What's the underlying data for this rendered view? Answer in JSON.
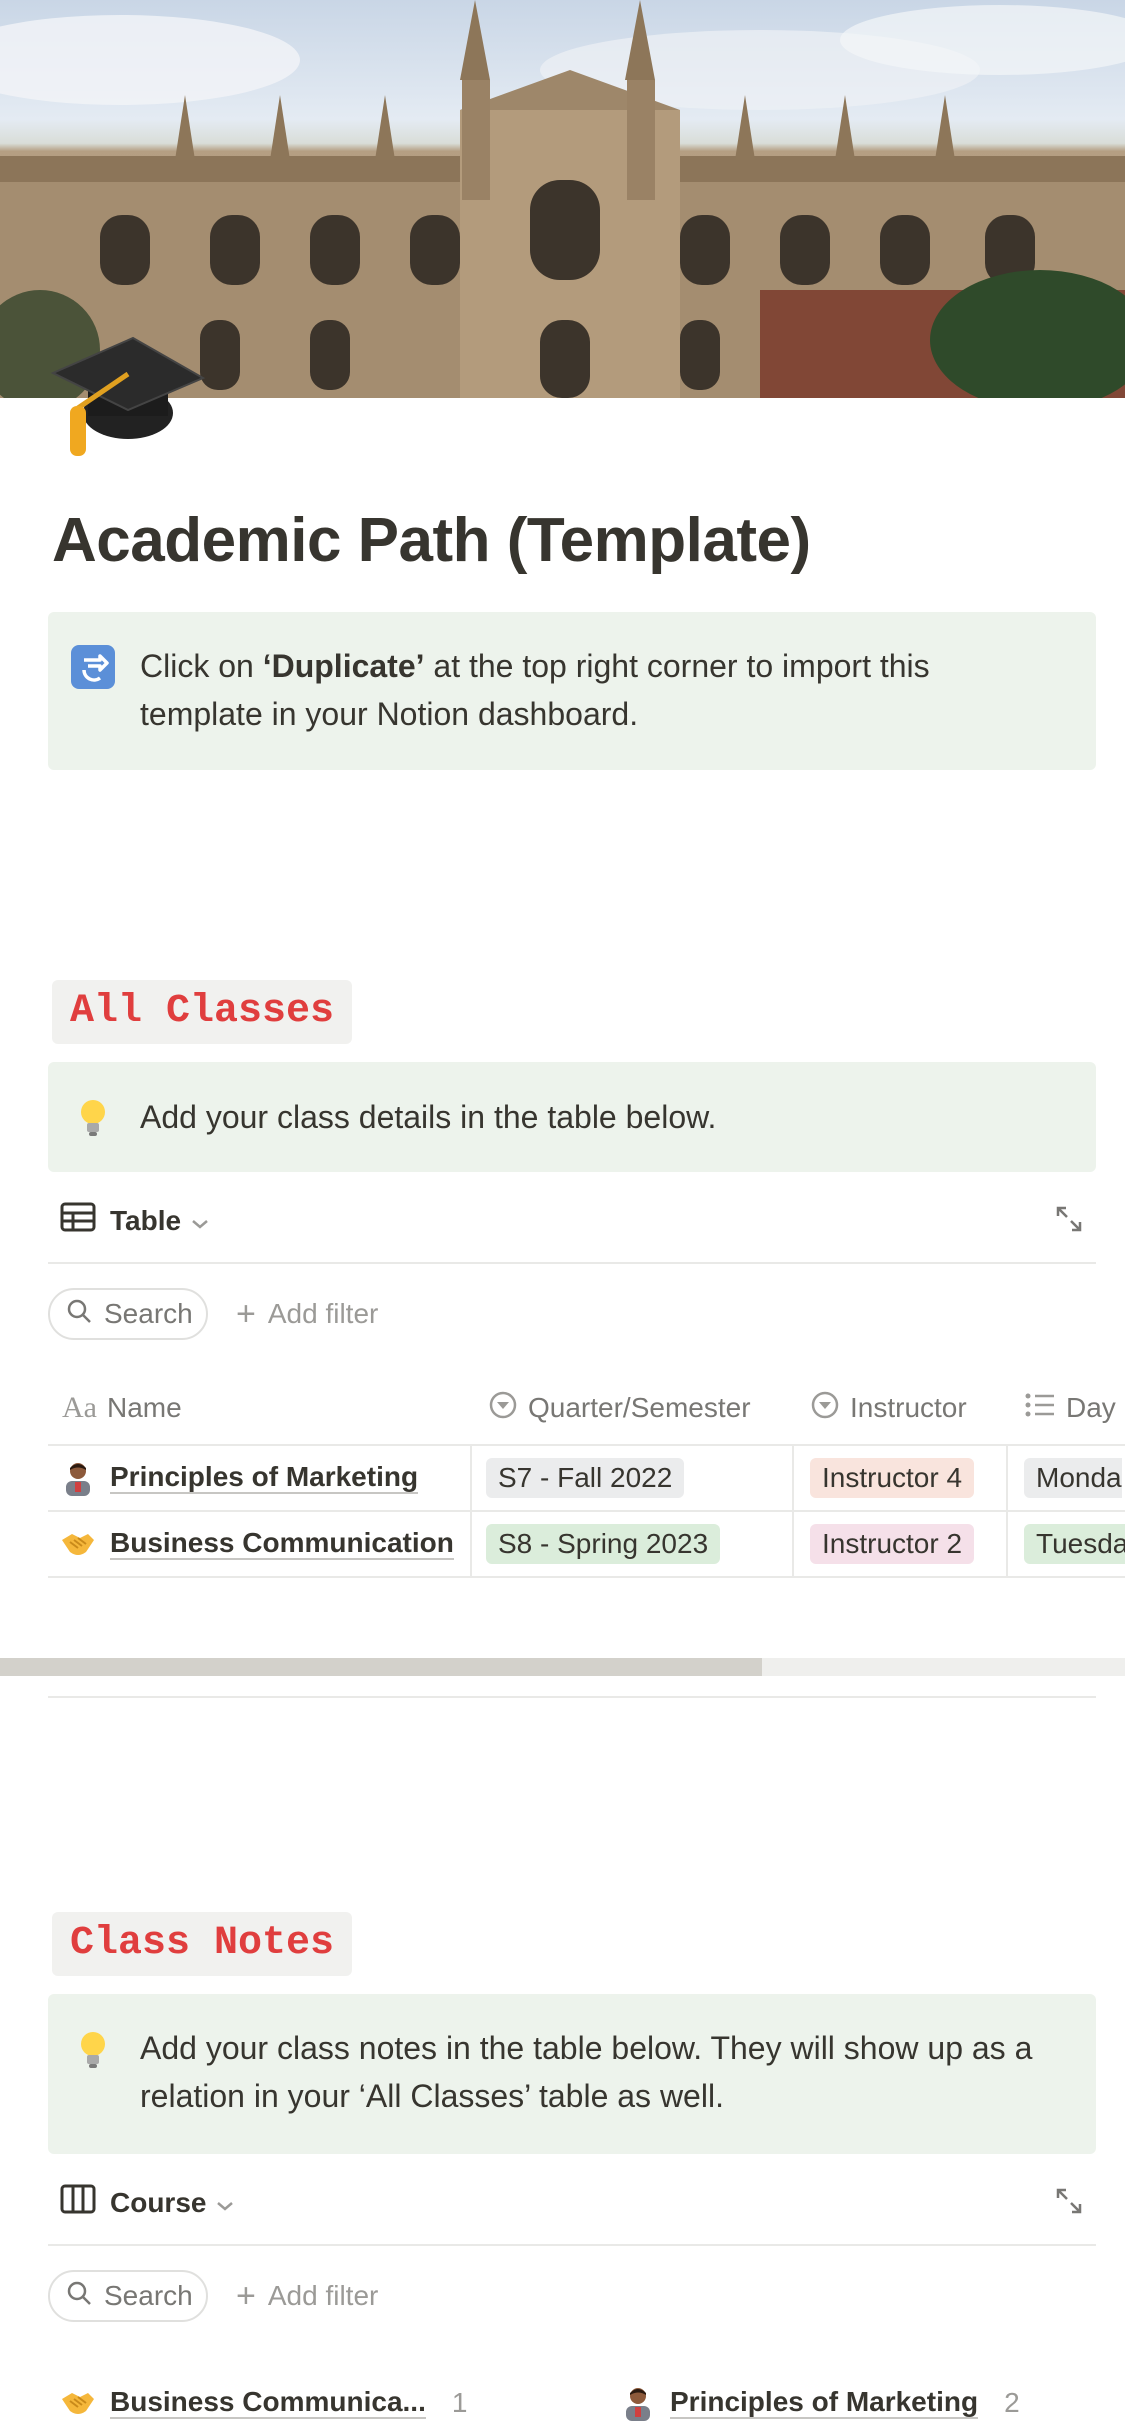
{
  "page": {
    "title": "Academic Path (Template)",
    "icon": "graduation-cap-icon"
  },
  "intro_callout": {
    "icon": "refresh-arrows-icon",
    "text_before": "Click on ",
    "text_bold": "‘Duplicate’",
    "text_after": " at the top right corner to import this template in your Notion dashboard."
  },
  "all_classes": {
    "heading": "All Classes",
    "callout": {
      "icon": "light-bulb-icon",
      "text": "Add your class details in the table below."
    },
    "view": {
      "label": "Table",
      "icon": "table-icon"
    },
    "search_label": "Search",
    "add_filter_label": "Add filter",
    "columns": [
      {
        "label": "Name",
        "icon": "text-aa-icon"
      },
      {
        "label": "Quarter/Semester",
        "icon": "select-icon"
      },
      {
        "label": "Instructor",
        "icon": "select-icon"
      },
      {
        "label": "Day",
        "icon": "list-icon"
      }
    ],
    "rows": [
      {
        "icon": "teacher-emoji-icon",
        "name": "Principles of Marketing",
        "quarter": {
          "label": "S7 - Fall 2022",
          "color": "#ebeced"
        },
        "instructor": {
          "label": "Instructor 4",
          "color": "#f9e4dd"
        },
        "day": {
          "label": "Monda",
          "color": "#ebeced"
        }
      },
      {
        "icon": "handshake-emoji-icon",
        "name": "Business Communication",
        "quarter": {
          "label": "S8 - Spring 2023",
          "color": "#dbeddb"
        },
        "instructor": {
          "label": "Instructor 2",
          "color": "#f5e0e9"
        },
        "day": {
          "label": "Tuesda",
          "color": "#dbeddb"
        }
      }
    ]
  },
  "class_notes": {
    "heading": "Class Notes",
    "callout": {
      "icon": "light-bulb-icon",
      "text": "Add your class notes in the table below. They will show up as a relation in your ‘All Classes’ table as well."
    },
    "view": {
      "label": "Course",
      "icon": "board-icon"
    },
    "search_label": "Search",
    "add_filter_label": "Add filter",
    "groups": [
      {
        "icon": "handshake-emoji-icon",
        "label": "Business Communica...",
        "count": "1"
      },
      {
        "icon": "teacher-emoji-icon",
        "label": "Principles of Marketing",
        "count": "2"
      }
    ]
  },
  "colors": {
    "callout_bg": "#edf3ec",
    "heading_red": "#e03e3e",
    "heading_bg": "#f1f1ef",
    "text": "#37352f",
    "muted": "#787774"
  }
}
